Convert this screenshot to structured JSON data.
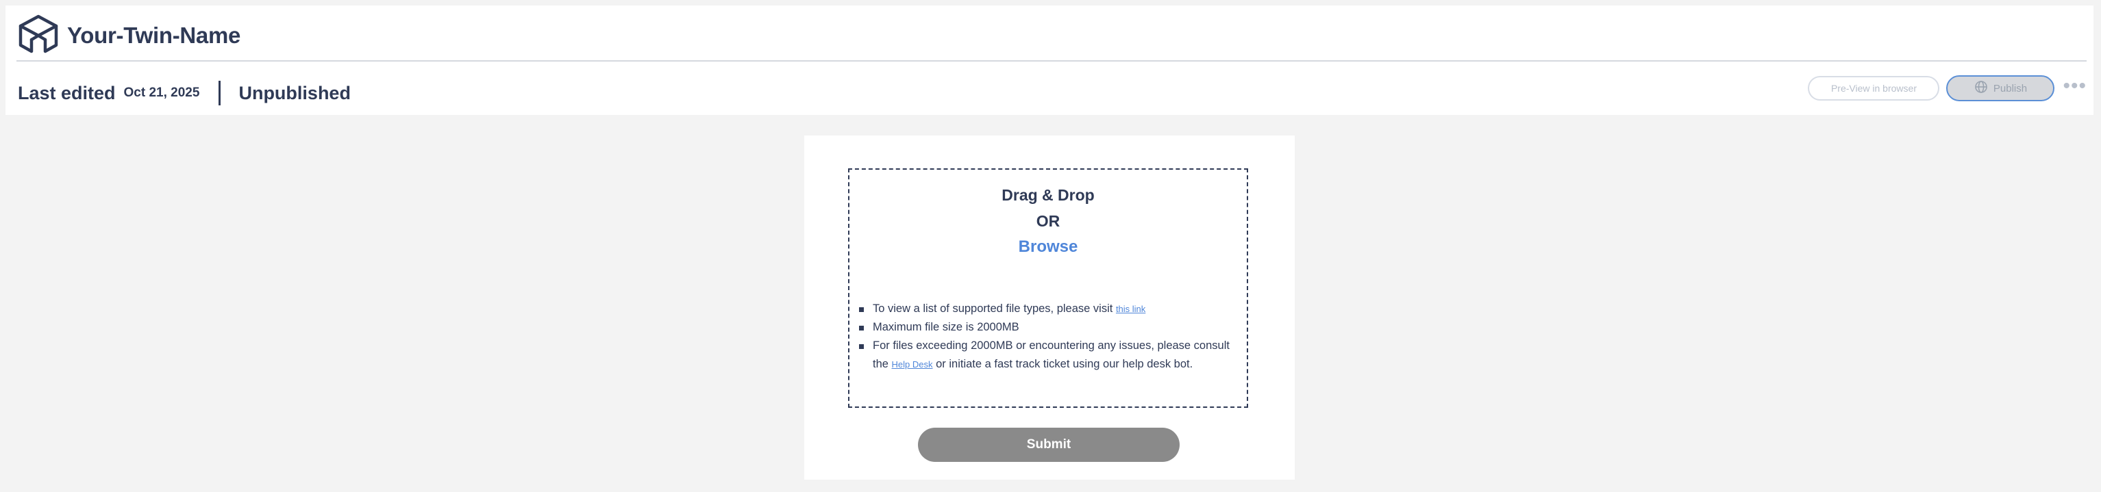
{
  "header": {
    "twin_name": "Your-Twin-Name",
    "logo_icon": "cube-icon"
  },
  "status": {
    "last_edited_label": "Last edited",
    "last_edited_date": "Oct 21, 2025",
    "publish_state": "Unpublished"
  },
  "actions": {
    "preview_label": "Pre-View in browser",
    "publish_label": "Publish",
    "publish_icon": "globe-icon",
    "more_icon": "more-dots-icon",
    "more_glyph": "•••"
  },
  "upload": {
    "title": "Drag & Drop",
    "or": "OR",
    "browse": "Browse",
    "notes": {
      "n0_text": "To view a list of supported file types, please visit",
      "n0_link": "this link",
      "n1_text": "Maximum file size is 2000MB",
      "n2_text_a": "For files exceeding 2000MB or encountering any issues, please consult the",
      "n2_link": "Help Desk",
      "n2_text_b": "or initiate a fast track ticket using our help desk bot."
    },
    "submit_label": "Submit"
  },
  "colors": {
    "text": "#2f3a56",
    "accent": "#4f86d9",
    "submit_bg": "#8a8a8a",
    "background": "#f3f3f3"
  }
}
